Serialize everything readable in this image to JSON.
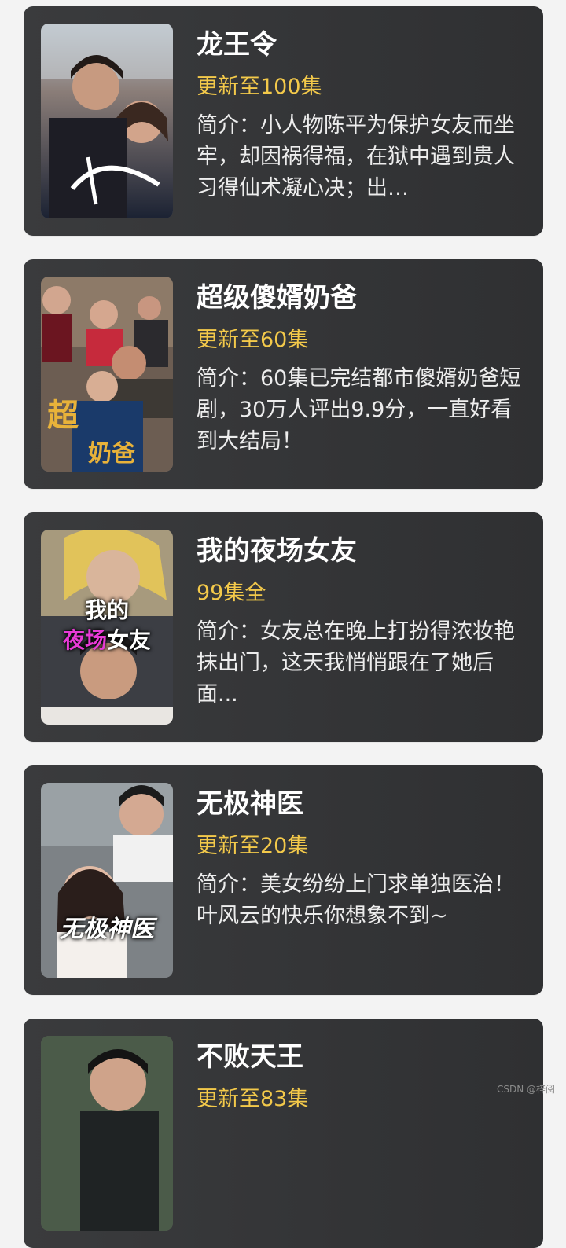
{
  "dramas": [
    {
      "title": "龙王令",
      "episodes": "更新至100集",
      "description": "简介：小人物陈平为保护女友而坐牢，却因祸得福，在狱中遇到贵人习得仙术凝心决；出…",
      "poster_icon": "poster-image"
    },
    {
      "title": "超级傻婿奶爸",
      "episodes": "更新至60集",
      "description": "简介：60集已完结都市傻婿奶爸短剧，30万人评出9.9分，一直好看到大结局！",
      "poster_icon": "poster-image"
    },
    {
      "title": "我的夜场女友",
      "episodes": "99集全",
      "description": "简介：女友总在晚上打扮得浓妆艳抹出门，这天我悄悄跟在了她后面...",
      "poster_icon": "poster-image",
      "poster_caption_line1": "我的",
      "poster_caption_pink": "夜场",
      "poster_caption_white": "女友"
    },
    {
      "title": "无极神医",
      "episodes": "更新至20集",
      "description": "简介：美女纷纷上门求单独医治！叶风云的快乐你想象不到~",
      "poster_icon": "poster-image",
      "poster_caption": "无极神医"
    },
    {
      "title": "不败天王",
      "episodes": "更新至83集",
      "description": "",
      "poster_icon": "poster-image"
    }
  ],
  "watermark": "CSDN @梓阅",
  "colors": {
    "card_bg": "#36373a",
    "page_bg": "#f3f3f3",
    "episodes_accent": "#f3c94a",
    "title": "#ffffff"
  }
}
